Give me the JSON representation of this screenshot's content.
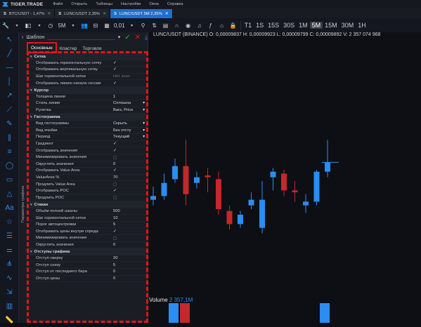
{
  "menubar": {
    "brand": "TIGER.TRADE",
    "items": [
      "Файл",
      "Открыть",
      "Таблицы",
      "Настройки",
      "Окна",
      "Справка"
    ]
  },
  "tabs": [
    {
      "label": "BTC/USDT - 1,47%",
      "active": false
    },
    {
      "label": "LUNC/USDT 2,35%",
      "active": false
    },
    {
      "label": "LUNC/USDT 5M 2,35%",
      "active": true
    }
  ],
  "toolbar": {
    "timeframe_current": "5M",
    "tick_size": "0,01",
    "timeframes": [
      "T1",
      "1S",
      "15S",
      "30S",
      "1M",
      "5M",
      "15M",
      "30M",
      "1H"
    ],
    "selected_timeframe": "5M"
  },
  "chart": {
    "symbol_line": "LUNC/USDT (BINANCE) O: 0,00009837 H: 0,00009923 L: 0,00009799 C: 0,00009892 V: 2 357 074 968",
    "volume_label": "Volume",
    "volume_value": "2 357,1M",
    "candles": [
      {
        "o": 9.8e-05,
        "h": 9.85e-05,
        "l": 9.75e-05,
        "c": 9.78e-05,
        "up": true
      },
      {
        "o": 9.8e-05,
        "h": 9.92e-05,
        "l": 9.78e-05,
        "c": 9.87e-05,
        "up": true
      },
      {
        "o": 9.96e-05,
        "h": 0.0001,
        "l": 9.87e-05,
        "c": 9.89e-05,
        "up": true
      },
      {
        "o": 9.96e-05,
        "h": 0.000101,
        "l": 9.75e-05,
        "c": 9.81e-05,
        "up": false
      },
      {
        "o": 9.9e-05,
        "h": 9.93e-05,
        "l": 9.84e-05,
        "c": 9.87e-05,
        "up": true
      },
      {
        "o": 9.91e-05,
        "h": 9.95e-05,
        "l": 9.82e-05,
        "c": 9.9e-05,
        "up": false
      },
      {
        "o": 9.89e-05,
        "h": 9.93e-05,
        "l": 9.7e-05,
        "c": 9.73e-05,
        "up": false
      },
      {
        "o": 9.72e-05,
        "h": 9.75e-05,
        "l": 9.62e-05,
        "c": 9.65e-05,
        "up": false
      },
      {
        "o": 9.65e-05,
        "h": 9.72e-05,
        "l": 9.63e-05,
        "c": 9.7e-05,
        "up": true
      },
      {
        "o": 9.75e-05,
        "h": 9.82e-05,
        "l": 9.73e-05,
        "c": 9.78e-05,
        "up": true
      },
      {
        "o": 9.78e-05,
        "h": 9.88e-05,
        "l": 9.6e-05,
        "c": 9.63e-05,
        "up": true
      },
      {
        "o": 9.9e-05,
        "h": 9.95e-05,
        "l": 9.83e-05,
        "c": 9.93e-05,
        "up": true
      },
      {
        "o": 9.92e-05,
        "h": 9.94e-05,
        "l": 9.8e-05,
        "c": 9.83e-05,
        "up": false
      },
      {
        "o": 9.83e-05,
        "h": 9.88e-05,
        "l": 9.77e-05,
        "c": 9.82e-05,
        "up": false
      },
      {
        "o": 9.75e-05,
        "h": 9.81e-05,
        "l": 9.71e-05,
        "c": 9.77e-05,
        "up": true
      },
      {
        "o": 9.77e-05,
        "h": 9.94e-05,
        "l": 9.75e-05,
        "c": 9.93e-05,
        "up": true
      },
      {
        "o": 9.93e-05,
        "h": 0.000101,
        "l": 9.9e-05,
        "c": 9.98e-05,
        "up": true
      }
    ]
  },
  "panel": {
    "template_label": "Шаблон",
    "tabs": [
      {
        "label": "Основные",
        "active": true
      },
      {
        "label": "Кластер",
        "active": false
      },
      {
        "label": "Торговля",
        "active": false
      }
    ],
    "vertical_label": "Параметры графика",
    "sections": [
      {
        "title": "Сетка",
        "rows": [
          {
            "key": "Отображать горизонтальную сетку",
            "value": "✓",
            "type": "check"
          },
          {
            "key": "Отображать вертикальную сетку",
            "value": "✓",
            "type": "check"
          },
          {
            "key": "Шаг горизонтальной сетки",
            "value": "Нет знач.",
            "type": "dim"
          },
          {
            "key": "Отображать линию начала сессии",
            "value": "✓",
            "type": "check"
          }
        ]
      },
      {
        "title": "Курсор",
        "rows": [
          {
            "key": "Толщина линии",
            "value": "1",
            "type": "text"
          },
          {
            "key": "Стиль линии",
            "value": "Сплошна",
            "type": "select"
          },
          {
            "key": "Рулетка",
            "value": "Bars, Price",
            "type": "select"
          }
        ]
      },
      {
        "title": "Гистограмма",
        "rows": [
          {
            "key": "Вид гистограммы",
            "value": "Скрыть",
            "type": "select"
          },
          {
            "key": "Вид ячейки",
            "value": "Без отсту",
            "type": "select"
          },
          {
            "key": "Период",
            "value": "Текущий",
            "type": "select"
          },
          {
            "key": "Градиент",
            "value": "✓",
            "type": "check"
          },
          {
            "key": "Отображать значения",
            "value": "✓",
            "type": "check"
          },
          {
            "key": "Минимизировать значения",
            "value": "",
            "type": "box"
          },
          {
            "key": "Округлять значения",
            "value": "0",
            "type": "text"
          },
          {
            "key": "Отображать Value Area",
            "value": "✓",
            "type": "check"
          },
          {
            "key": "ValueArea %",
            "value": "70",
            "type": "text"
          },
          {
            "key": "Продлить Value Area",
            "value": "",
            "type": "box"
          },
          {
            "key": "Отображать POC",
            "value": "✓",
            "type": "check"
          },
          {
            "key": "Продлить POC",
            "value": "",
            "type": "box"
          }
        ]
      },
      {
        "title": "Стакан",
        "rows": [
          {
            "key": "Объём полной шкалы",
            "value": "500",
            "type": "text"
          },
          {
            "key": "Шаг горизонтальной сетки",
            "value": "10",
            "type": "text"
          },
          {
            "key": "Порог автоцентровки",
            "value": "5",
            "type": "text"
          },
          {
            "key": "Отображать цены внутри спреда",
            "value": "✓",
            "type": "check"
          },
          {
            "key": "Минимизировать значения",
            "value": "",
            "type": "box"
          },
          {
            "key": "Округлять значения",
            "value": "0",
            "type": "text"
          }
        ]
      },
      {
        "title": "Отступы графика",
        "rows": [
          {
            "key": "Отступ сверху",
            "value": "20",
            "type": "text"
          },
          {
            "key": "Отступ снизу",
            "value": "5",
            "type": "text"
          },
          {
            "key": "Отступ от последнего бара",
            "value": "0",
            "type": "text"
          },
          {
            "key": "Отступ цены",
            "value": "0",
            "type": "text"
          }
        ]
      }
    ]
  },
  "colors": {
    "accent": "#2d8cf0",
    "down": "#c4282c",
    "highlight": "#e01818",
    "active_tab": "#1f6fd1"
  }
}
